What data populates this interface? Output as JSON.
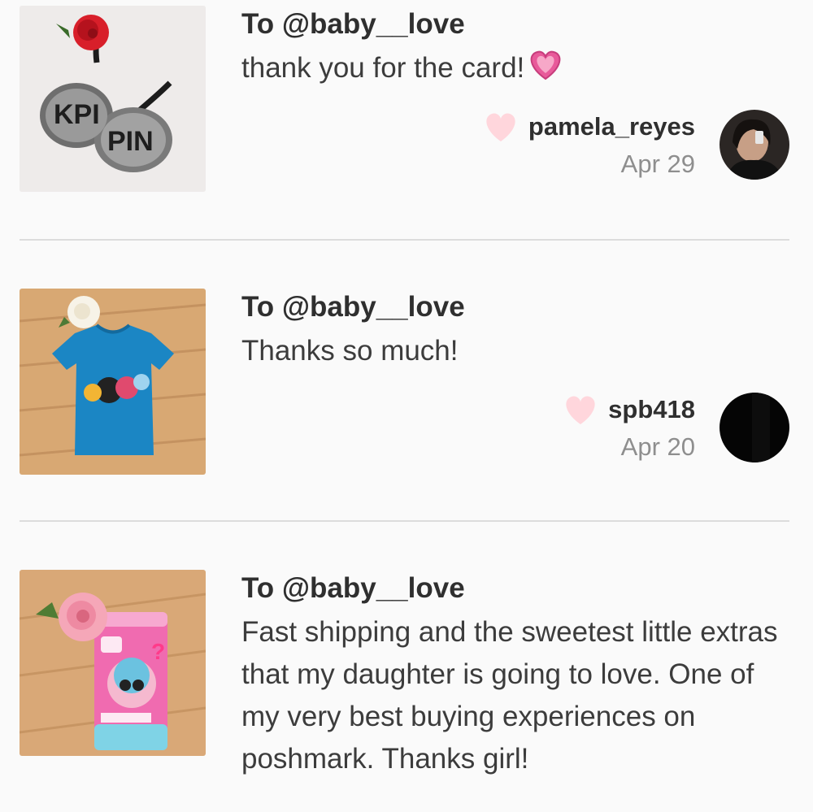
{
  "notes": [
    {
      "recipient": "To @baby__love",
      "message": "thank you for the card!",
      "message_emoji": "pink-heart-icon",
      "sender": "pamela_reyes",
      "date": "Apr 29",
      "thumbnail": "bra-with-red-flower",
      "liked": false
    },
    {
      "recipient": "To @baby__love",
      "message": "Thanks so much!",
      "sender": "spb418",
      "date": "Apr 20",
      "thumbnail": "blue-tshirt-with-white-flower",
      "liked": false
    },
    {
      "recipient": "To @baby__love",
      "message": "Fast shipping and the sweetest little extras that my daughter is going to love. One of my very best buying experiences on poshmark. Thanks girl!",
      "thumbnail": "lol-surprise-toy-with-pink-flower"
    }
  ],
  "colors": {
    "background": "#fafafa",
    "heart": "#ffd6dc",
    "divider": "#dcdcdc",
    "date_text": "#8e8e8e",
    "emoji_heart": "#e85a9a"
  }
}
